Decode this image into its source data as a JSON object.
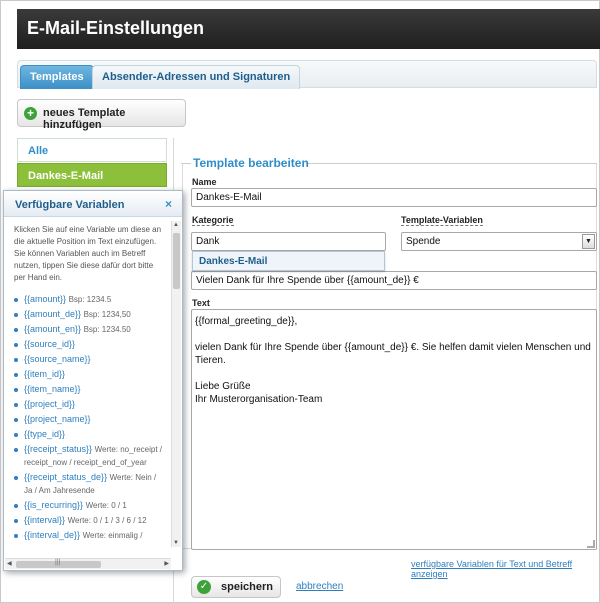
{
  "header": {
    "title": "E-Mail-Einstellungen"
  },
  "tabs": [
    {
      "label": "Templates",
      "active": true
    },
    {
      "label": "Absender-Adressen und Signaturen",
      "active": false
    }
  ],
  "add_template_button": {
    "label": "neues Template hinzufügen",
    "icon": "plus-circle-icon"
  },
  "sidebar": {
    "items": [
      {
        "label": "Alle"
      },
      {
        "label": "Dankes-E-Mail"
      }
    ]
  },
  "form": {
    "section_title": "Template bearbeiten",
    "name_label": "Name",
    "name_value": "Dankes-E-Mail",
    "kategorie_label": "Kategorie",
    "kategorie_value": "Dank",
    "template_vars_label": "Template-Variablen",
    "template_vars_value": "Spende",
    "autocomplete_option": "Dankes-E-Mail",
    "betreff_value": "Vielen Dank für Ihre Spende über {{amount_de}} €",
    "text_label": "Text",
    "text_lines": [
      "{{formal_greeting_de}},",
      "vielen Dank für Ihre Spende über {{amount_de}} €. Sie helfen damit vielen Menschen und Tieren.",
      "Liebe Grüße",
      "Ihr Musterorganisation-Team"
    ],
    "vars_link": "verfügbare Variablen für Text und Betreff anzeigen",
    "save_label": "speichern",
    "cancel_label": "abbrechen"
  },
  "popup": {
    "title": "Verfügbare Variablen",
    "close_glyph": "×",
    "intro": "Klicken Sie auf eine Variable um diese an die aktuelle Position im Text einzufügen. Sie können Variablen auch im Betreff nutzen, tippen Sie diese dafür dort bitte per Hand ein.",
    "variables": [
      {
        "name": "{{amount}}",
        "note": "Bsp: 1234.5"
      },
      {
        "name": "{{amount_de}}",
        "note": "Bsp: 1234,50"
      },
      {
        "name": "{{amount_en}}",
        "note": "Bsp: 1234.50"
      },
      {
        "name": "{{source_id}}",
        "note": ""
      },
      {
        "name": "{{source_name}}",
        "note": ""
      },
      {
        "name": "{{item_id}}",
        "note": ""
      },
      {
        "name": "{{item_name}}",
        "note": ""
      },
      {
        "name": "{{project_id}}",
        "note": ""
      },
      {
        "name": "{{project_name}}",
        "note": ""
      },
      {
        "name": "{{type_id}}",
        "note": ""
      },
      {
        "name": "{{receipt_status}}",
        "note": "Werte: no_receipt / receipt_now / receipt_end_of_year"
      },
      {
        "name": "{{receipt_status_de}}",
        "note": "Werte: Nein / Ja / Am Jahresende"
      },
      {
        "name": "{{is_recurring}}",
        "note": "Werte: 0 / 1"
      },
      {
        "name": "{{interval}}",
        "note": "Werte: 0 / 1 / 3 / 6 / 12"
      },
      {
        "name": "{{interval_de}}",
        "note": "Werte: einmalig /"
      }
    ]
  }
}
